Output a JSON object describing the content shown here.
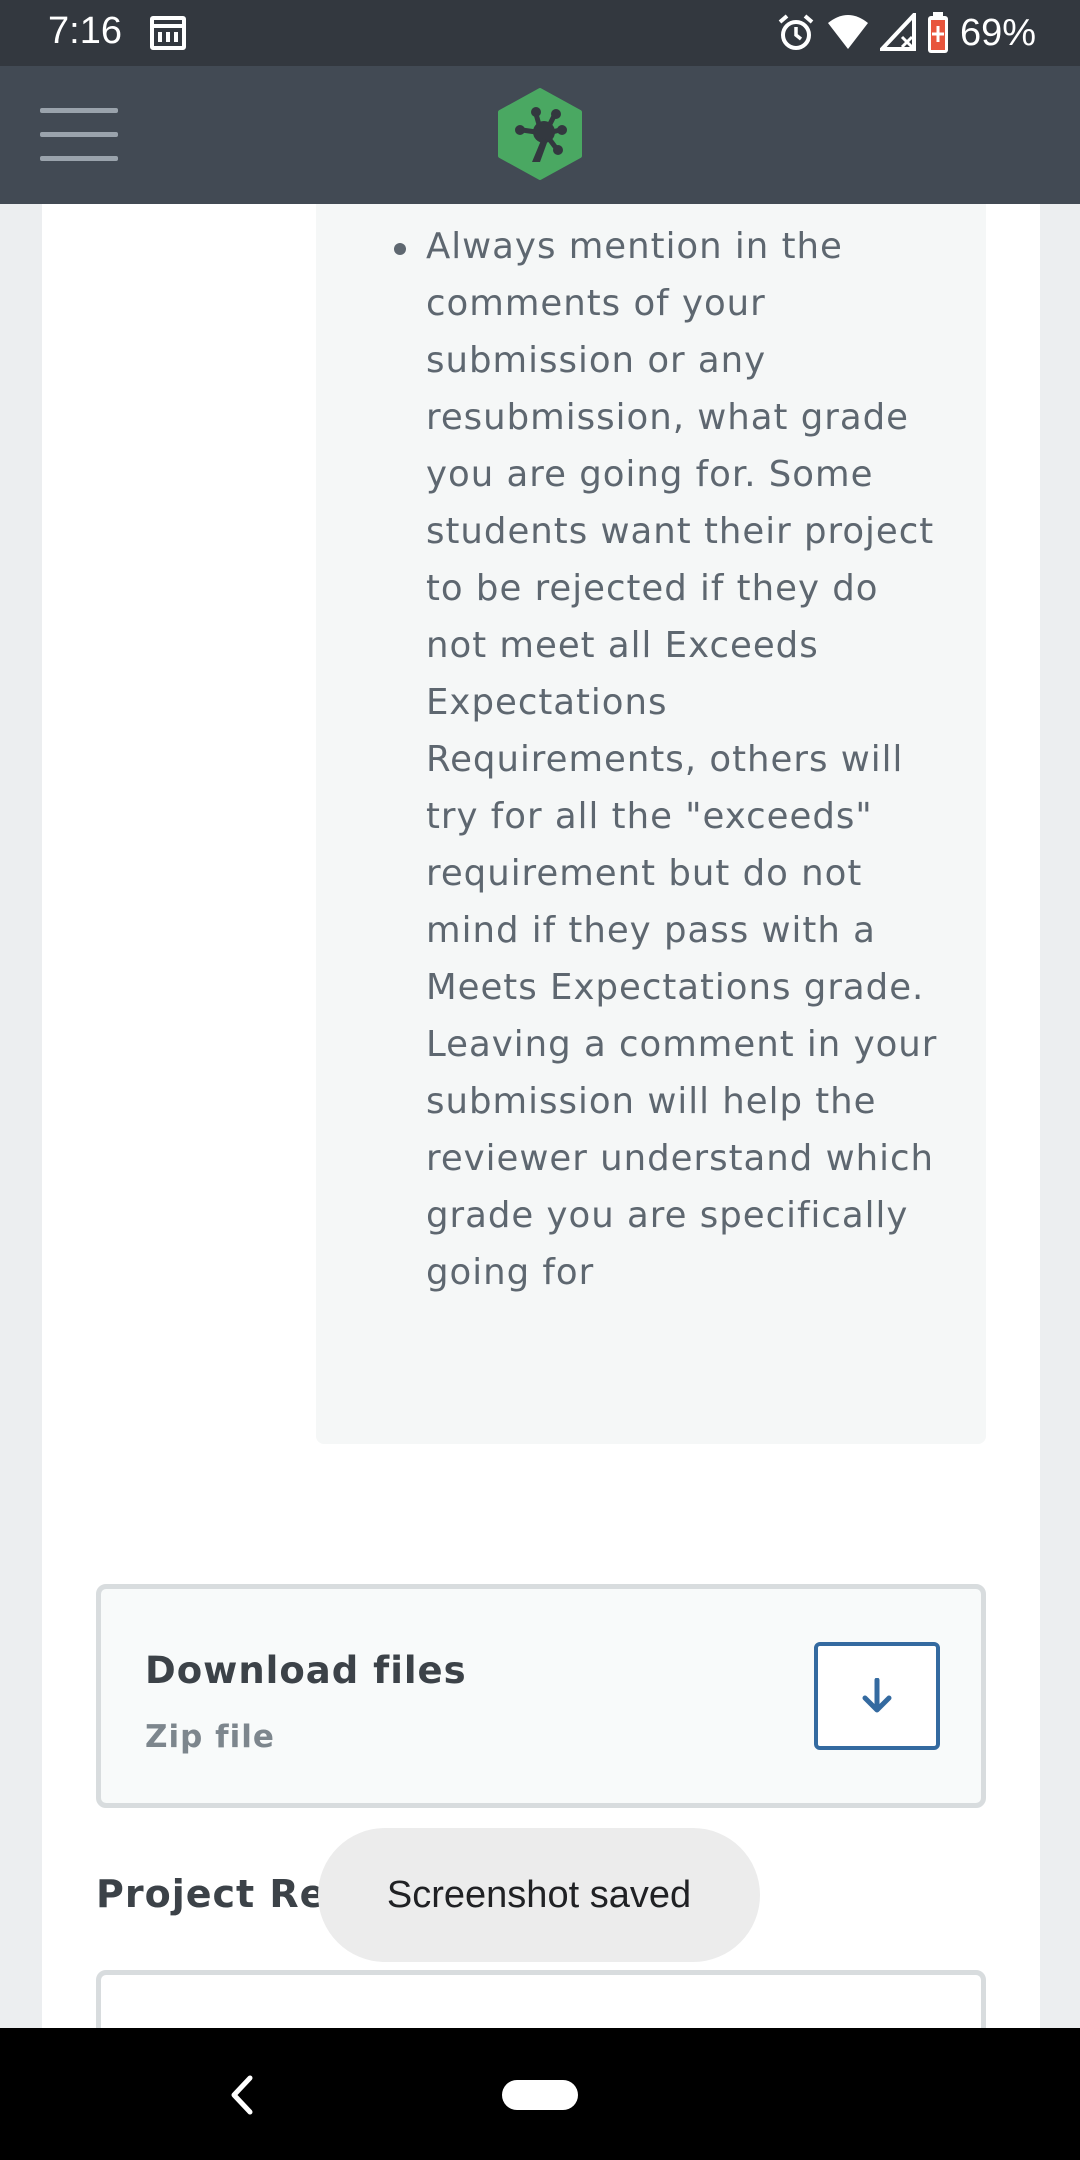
{
  "status_bar": {
    "time": "7:16",
    "battery_percent": "69%",
    "icons": [
      "calendar-icon",
      "alarm-icon",
      "wifi-icon",
      "signal-icon",
      "battery-icon"
    ]
  },
  "app_bar": {
    "menu_icon": "hamburger-menu-icon",
    "logo_icon": "treehouse-logo-icon",
    "brand_color": "#4aa862"
  },
  "instructions": {
    "note_text": "Always mention in the comments of your submission or any resubmission, what grade you are going for. Some students want their project to be rejected if they do not meet all Exceeds Expectations Requirements, others will try for all the \"exceeds\" requirement but do not mind if they pass with a Meets Expectations grade. Leaving a comment in your submission will help the reviewer understand which grade you are specifically going for"
  },
  "download": {
    "title": "Download files",
    "subtitle": "Zip file",
    "button_icon": "arrow-down-icon",
    "accent_color": "#346aa0"
  },
  "resources": {
    "title": "Project Resources"
  },
  "toast": {
    "message": "Screenshot saved"
  },
  "nav_bar": {
    "back_icon": "back-chevron-icon",
    "home_icon": "home-pill-icon"
  }
}
